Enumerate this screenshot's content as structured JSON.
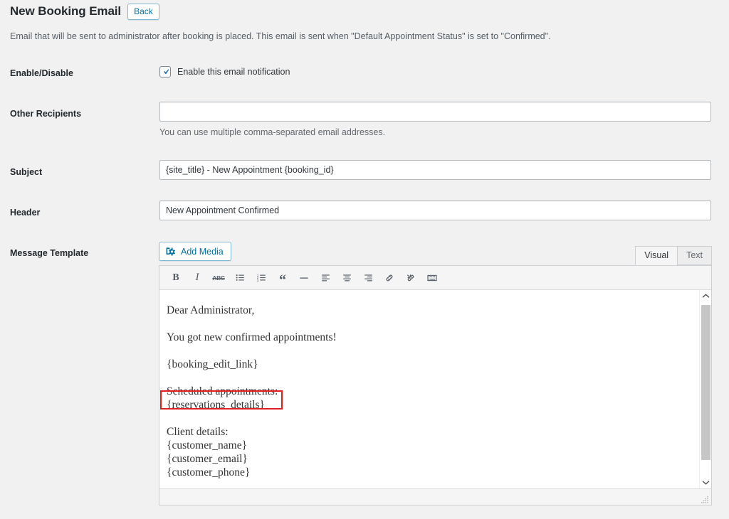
{
  "header": {
    "title": "New Booking Email",
    "back_label": "Back",
    "description": "Email that will be sent to administrator after booking is placed. This email is sent when \"Default Appointment Status\" is set to \"Confirmed\"."
  },
  "form": {
    "enable": {
      "label": "Enable/Disable",
      "checkbox_label": "Enable this email notification",
      "checked": true
    },
    "other_recipients": {
      "label": "Other Recipients",
      "value": "",
      "placeholder": "",
      "hint": "You can use multiple comma-separated email addresses."
    },
    "subject": {
      "label": "Subject",
      "value": "{site_title} - New Appointment {booking_id}"
    },
    "email_header": {
      "label": "Header",
      "value": "New Appointment Confirmed"
    },
    "message_template": {
      "label": "Message Template"
    }
  },
  "editor": {
    "add_media_label": "Add Media",
    "add_media_icon": "media-icon",
    "tabs": [
      {
        "label": "Visual",
        "active": true
      },
      {
        "label": "Text",
        "active": false
      }
    ],
    "toolbar": [
      {
        "name": "bold-button",
        "glyph": "B",
        "title": "Bold"
      },
      {
        "name": "italic-button",
        "glyph": "I",
        "title": "Italic"
      },
      {
        "name": "strikethrough-button",
        "glyph": "ABC",
        "title": "Strikethrough"
      },
      {
        "name": "bulleted-list-button",
        "glyph": "",
        "title": "Bulleted list"
      },
      {
        "name": "numbered-list-button",
        "glyph": "",
        "title": "Numbered list"
      },
      {
        "name": "blockquote-button",
        "glyph": "“",
        "title": "Blockquote"
      },
      {
        "name": "horizontal-rule-button",
        "glyph": "",
        "title": "Horizontal line"
      },
      {
        "name": "align-left-button",
        "glyph": "",
        "title": "Align left"
      },
      {
        "name": "align-center-button",
        "glyph": "",
        "title": "Align center"
      },
      {
        "name": "align-right-button",
        "glyph": "",
        "title": "Align right"
      },
      {
        "name": "insert-link-button",
        "glyph": "",
        "title": "Insert link"
      },
      {
        "name": "remove-link-button",
        "glyph": "",
        "title": "Remove link"
      },
      {
        "name": "toolbar-toggle-button",
        "glyph": "",
        "title": "Toolbar toggle"
      }
    ],
    "content": {
      "paragraphs": [
        "Dear Administrator,",
        "You got new confirmed appointments!",
        "{booking_edit_link}"
      ],
      "scheduled_label": "Scheduled appointments:",
      "reservations_token": "{reservations_details}",
      "client_label": "Client details:",
      "client_tokens": [
        "{customer_name}",
        "{customer_email}",
        "{customer_phone}"
      ]
    }
  },
  "annotation": {
    "color": "#e02020",
    "target": "{reservations_details}"
  }
}
